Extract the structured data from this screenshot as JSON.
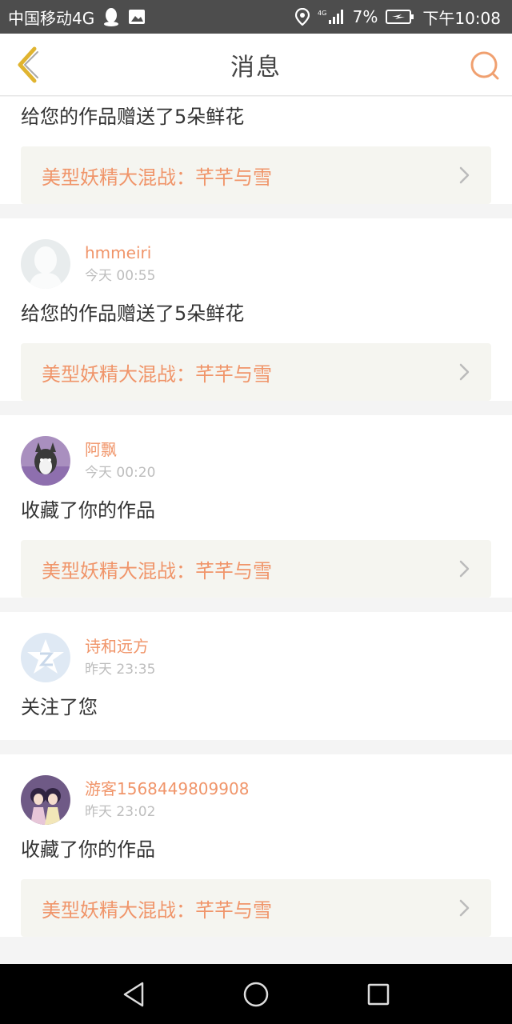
{
  "status_bar": {
    "carrier": "中国移动4G",
    "battery": "7%",
    "time": "下午10:08",
    "network": "4G"
  },
  "header": {
    "title": "消息"
  },
  "colors": {
    "accent": "#f0956a",
    "header_icon": "#f0a070",
    "back_icon": "#e0b430"
  },
  "messages": [
    {
      "action": "给您的作品赠送了5朵鲜花",
      "work_title": "美型妖精大混战：芊芊与雪"
    },
    {
      "username": "hmmeiri",
      "time": "今天 00:55",
      "action": "给您的作品赠送了5朵鲜花",
      "work_title": "美型妖精大混战：芊芊与雪"
    },
    {
      "username": "阿飘",
      "time": "今天 00:20",
      "action": "收藏了你的作品",
      "work_title": "美型妖精大混战：芊芊与雪"
    },
    {
      "username": "诗和远方",
      "time": "昨天 23:35",
      "action": "关注了您"
    },
    {
      "username": "游客1568449809908",
      "time": "昨天 23:02",
      "action": "收藏了你的作品",
      "work_title": "美型妖精大混战：芊芊与雪"
    }
  ]
}
